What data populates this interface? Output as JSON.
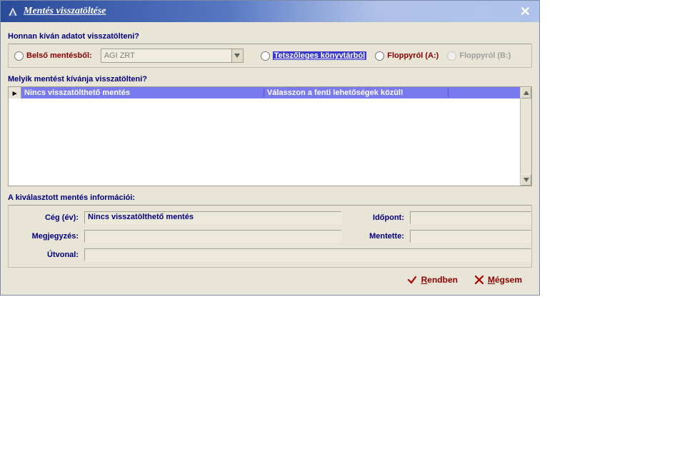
{
  "title": "Mentés visszatöltése",
  "q1": "Honnan kíván adatot visszatölteni?",
  "radios": {
    "r1": "Belső mentésből:",
    "combo": "AGI ZRT",
    "r2": "Tetszőleges könyvtárból",
    "r3": "Floppyról (A:)",
    "r4": "Floppyról (B:)"
  },
  "q2": "Melyik mentést kívánja visszatölteni?",
  "list": {
    "marker": "▸",
    "c1": "Nincs visszatölthető mentés",
    "c2": "Válasszon a fenti lehetőségek közül!",
    "c3": ""
  },
  "q3": "A kiválasztott mentés információi:",
  "info": {
    "ceg_label": "Cég (év):",
    "ceg_value": "Nincs visszatölthető mentés",
    "idopont_label": "Időpont:",
    "idopont_value": "",
    "megj_label": "Megjegyzés:",
    "megj_value": "",
    "mentette_label": "Mentette:",
    "mentette_value": "",
    "utvonal_label": "Útvonal:",
    "utvonal_value": ""
  },
  "buttons": {
    "ok_pre": "",
    "ok_u": "R",
    "ok_post": "endben",
    "cancel_pre": "",
    "cancel_u": "M",
    "cancel_post": "égsem"
  }
}
